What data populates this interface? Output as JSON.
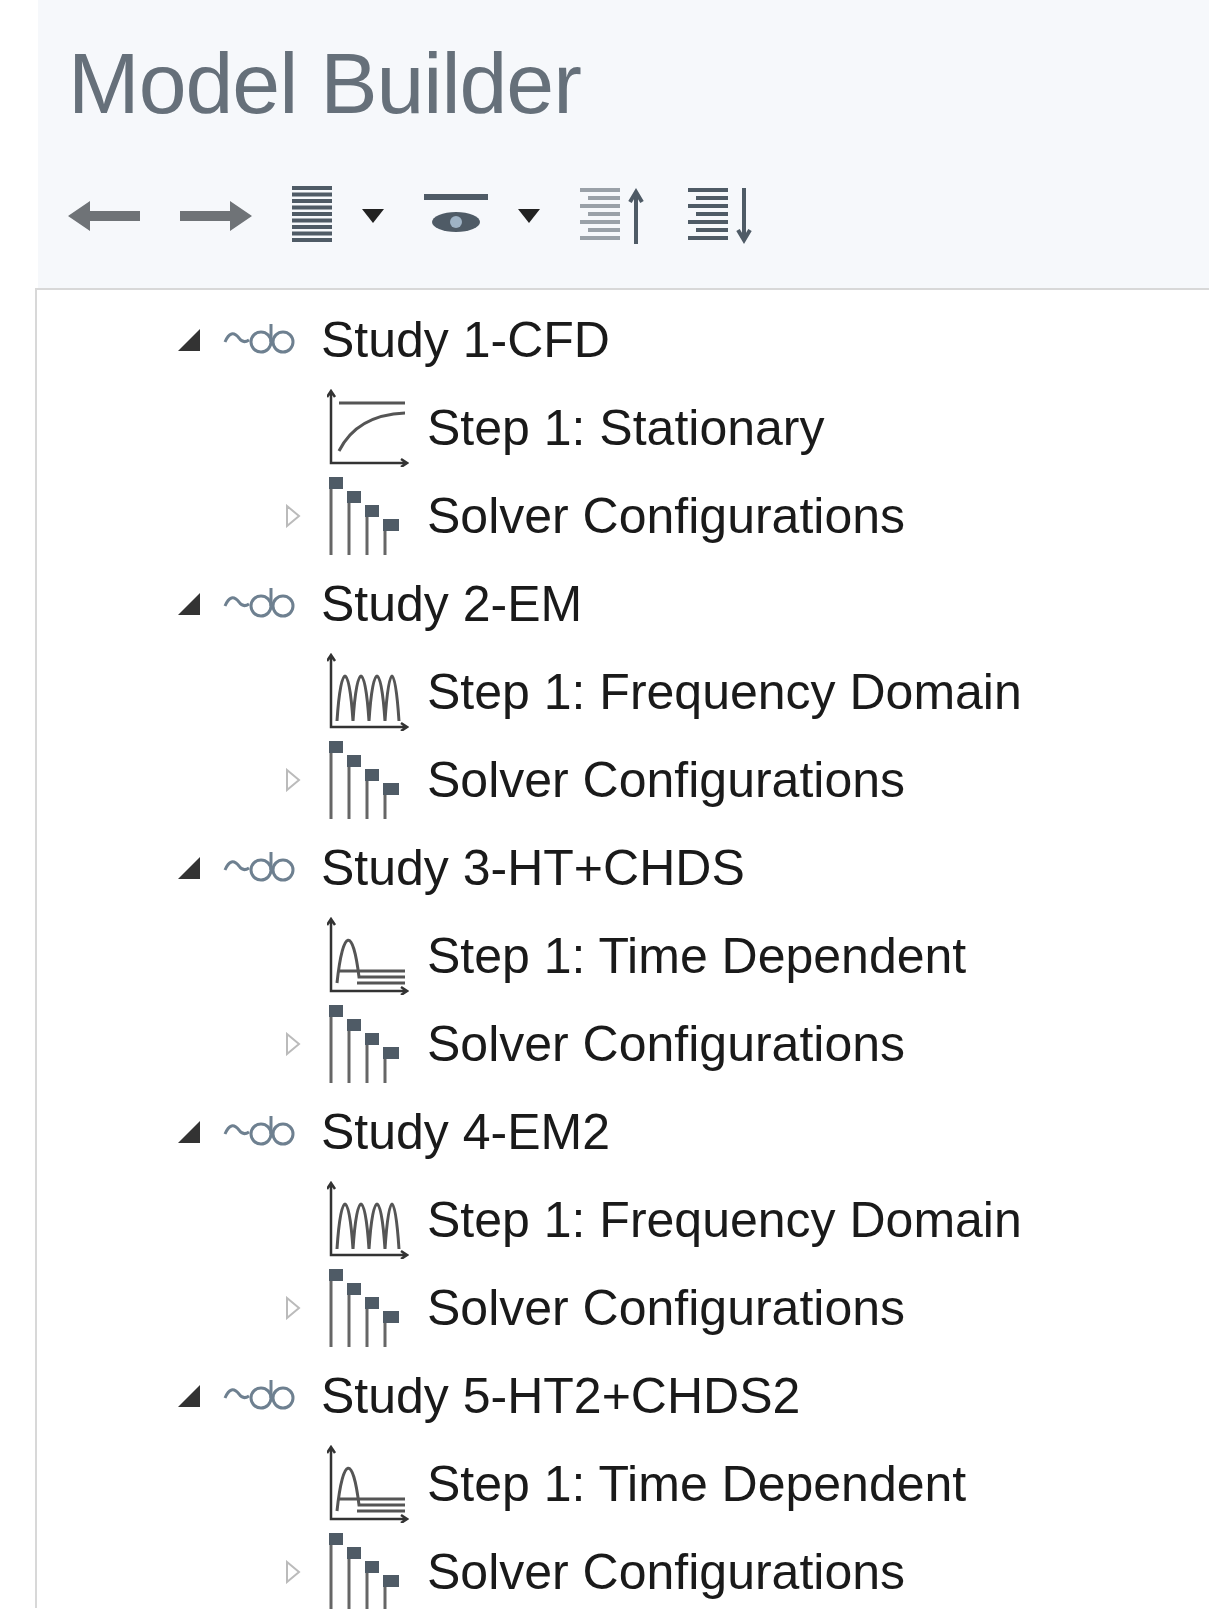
{
  "panel": {
    "title": "Model Builder"
  },
  "toolbar": [
    {
      "kind": "back"
    },
    {
      "kind": "forward"
    },
    {
      "kind": "list",
      "menu": true
    },
    {
      "kind": "eye",
      "menu": true
    },
    {
      "kind": "collapse"
    },
    {
      "kind": "expand"
    }
  ],
  "tree": [
    {
      "label": "Study 1-CFD",
      "expanded": true,
      "children": [
        {
          "label": "Step 1: Stationary",
          "kind": "stationary"
        },
        {
          "label": "Solver Configurations",
          "kind": "solver",
          "expanded": false
        }
      ]
    },
    {
      "label": "Study 2-EM",
      "expanded": true,
      "children": [
        {
          "label": "Step 1: Frequency Domain",
          "kind": "frequency"
        },
        {
          "label": "Solver Configurations",
          "kind": "solver",
          "expanded": false
        }
      ]
    },
    {
      "label": "Study 3-HT+CHDS",
      "expanded": true,
      "children": [
        {
          "label": "Step 1: Time Dependent",
          "kind": "time"
        },
        {
          "label": "Solver Configurations",
          "kind": "solver",
          "expanded": false
        }
      ]
    },
    {
      "label": "Study 4-EM2",
      "expanded": true,
      "children": [
        {
          "label": "Step 1: Frequency Domain",
          "kind": "frequency"
        },
        {
          "label": "Solver Configurations",
          "kind": "solver",
          "expanded": false
        }
      ]
    },
    {
      "label": "Study 5-HT2+CHDS2",
      "expanded": true,
      "children": [
        {
          "label": "Step 1: Time Dependent",
          "kind": "time"
        },
        {
          "label": "Solver Configurations",
          "kind": "solver",
          "expanded": false
        }
      ]
    }
  ]
}
